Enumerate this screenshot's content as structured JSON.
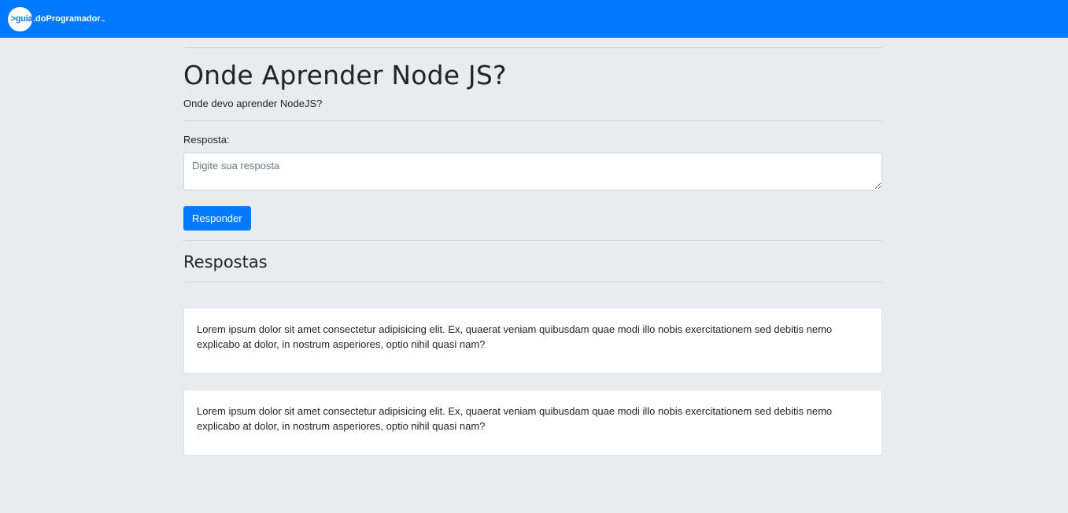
{
  "navbar": {
    "logo_mark": ">guia",
    "logo_text": ".doProgramador"
  },
  "question": {
    "title": "Onde Aprender Node JS?",
    "description": "Onde devo aprender NodeJS?"
  },
  "form": {
    "label": "Resposta:",
    "placeholder": "Digite sua resposta",
    "value": "",
    "submit_label": "Responder"
  },
  "answers_section": {
    "title": "Respostas",
    "items": [
      {
        "text": "Lorem ipsum dolor sit amet consectetur adipisicing elit. Ex, quaerat veniam quibusdam quae modi illo nobis exercitationem sed debitis nemo explicabo at dolor, in nostrum asperiores, optio nihil quasi nam?"
      },
      {
        "text": "Lorem ipsum dolor sit amet consectetur adipisicing elit. Ex, quaerat veniam quibusdam quae modi illo nobis exercitationem sed debitis nemo explicabo at dolor, in nostrum asperiores, optio nihil quasi nam?"
      }
    ]
  },
  "colors": {
    "primary": "#007bff",
    "background": "#e9ecef"
  }
}
